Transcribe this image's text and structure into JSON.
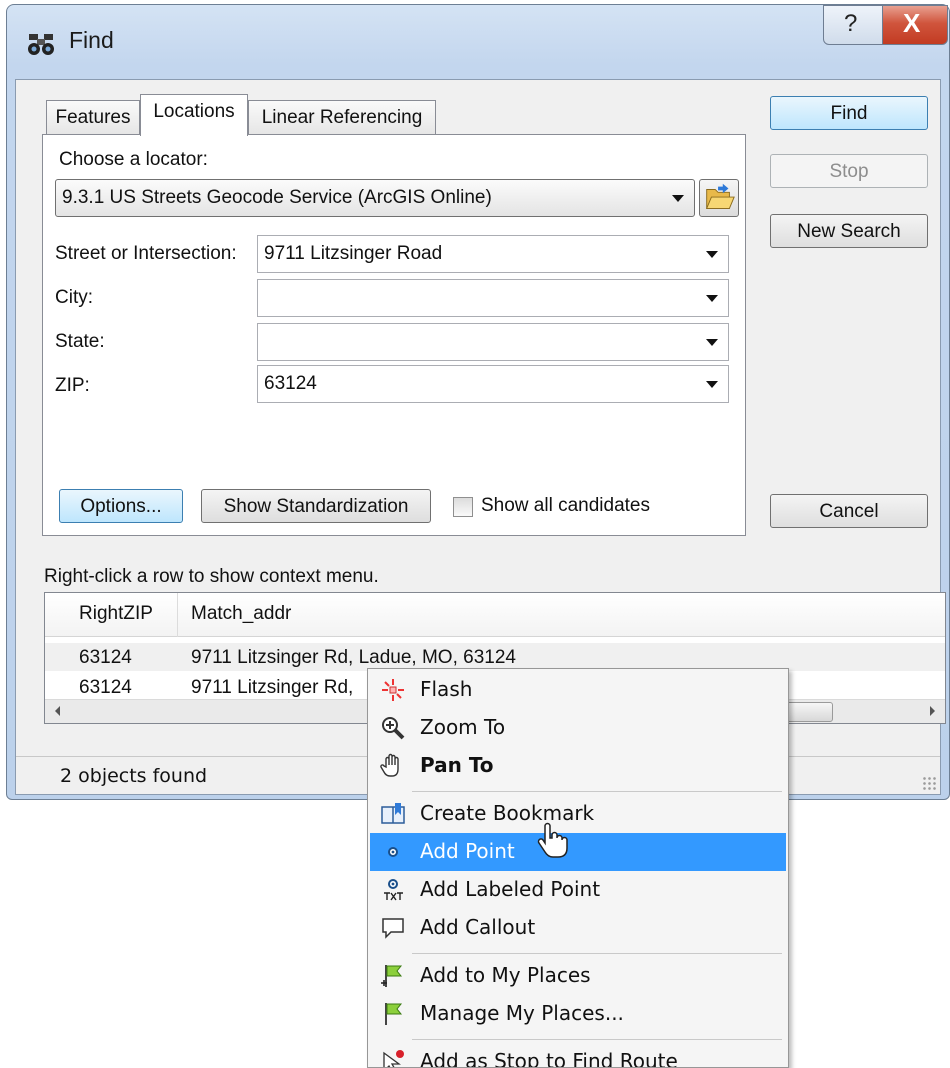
{
  "window": {
    "title": "Find",
    "help_glyph": "?",
    "close_glyph": "X"
  },
  "tabs": [
    {
      "label": "Features"
    },
    {
      "label": "Locations"
    },
    {
      "label": "Linear Referencing"
    }
  ],
  "locations": {
    "locator_label": "Choose a locator:",
    "locator_value": "9.3.1 US Streets Geocode Service (ArcGIS Online)",
    "fields": [
      {
        "label": "Street or Intersection:",
        "value": "9711 Litzsinger Road"
      },
      {
        "label": "City:",
        "value": ""
      },
      {
        "label": "State:",
        "value": ""
      },
      {
        "label": "ZIP:",
        "value": "63124"
      }
    ],
    "options_label": "Options...",
    "standardization_label": "Show Standardization",
    "show_all_label": "Show all candidates"
  },
  "side_buttons": {
    "find": "Find",
    "stop": "Stop",
    "new_search": "New Search",
    "cancel": "Cancel"
  },
  "results": {
    "hint": "Right-click a row to show context menu.",
    "columns": [
      "RightZIP",
      "Match_addr"
    ],
    "rows": [
      {
        "zip": "63124",
        "addr": "9711 Litzsinger Rd, Ladue, MO, 63124"
      },
      {
        "zip": "63124",
        "addr": "9711 Litzsinger Rd,"
      }
    ]
  },
  "status": {
    "text": "2 objects found"
  },
  "context_menu": {
    "items": [
      {
        "label": "Flash",
        "icon": "flash-icon"
      },
      {
        "label": "Zoom To",
        "icon": "zoom-in-icon"
      },
      {
        "label": "Pan To",
        "icon": "pan-hand-icon"
      },
      {
        "label": "Create Bookmark",
        "icon": "bookmark-icon"
      },
      {
        "label": "Add Point",
        "icon": "point-icon"
      },
      {
        "label": "Add Labeled Point",
        "icon": "labeled-point-icon"
      },
      {
        "label": "Add Callout",
        "icon": "callout-icon"
      },
      {
        "label": "Add to My Places",
        "icon": "add-flag-icon"
      },
      {
        "label": "Manage My Places...",
        "icon": "flag-icon"
      },
      {
        "label": "Add as Stop to Find Route",
        "icon": "route-stop-icon"
      }
    ],
    "highlight_color": "#3399ff"
  }
}
